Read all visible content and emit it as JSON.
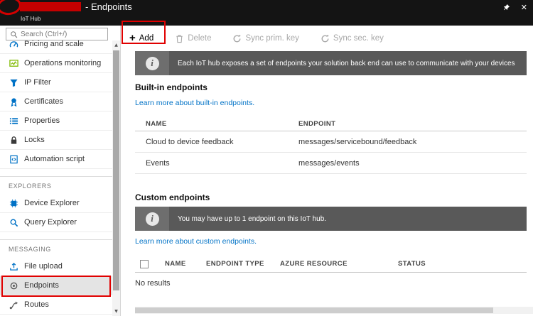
{
  "header": {
    "title": "- Endpoints",
    "subtitle": "IoT Hub"
  },
  "icons": {
    "close": "✕",
    "scroll_up": "▲",
    "scroll_down": "▼",
    "add_plus": "+",
    "info": "i"
  },
  "colors": {
    "annotation_red": "#e00000",
    "link_blue": "#0072c6",
    "banner_gray": "#595959",
    "topbar_black": "#141414"
  },
  "sidebar": {
    "search_placeholder": "Search (Ctrl+/)",
    "sections": {
      "explorers": "EXPLORERS",
      "messaging": "MESSAGING"
    },
    "items": [
      {
        "label": "Pricing and scale"
      },
      {
        "label": "Operations monitoring"
      },
      {
        "label": "IP Filter"
      },
      {
        "label": "Certificates"
      },
      {
        "label": "Properties"
      },
      {
        "label": "Locks"
      },
      {
        "label": "Automation script"
      },
      {
        "label": "Device Explorer"
      },
      {
        "label": "Query Explorer"
      },
      {
        "label": "File upload"
      },
      {
        "label": "Endpoints"
      },
      {
        "label": "Routes"
      }
    ]
  },
  "toolbar": {
    "add_label": "Add",
    "delete_label": "Delete",
    "sync_prim_label": "Sync prim. key",
    "sync_sec_label": "Sync sec. key"
  },
  "main": {
    "intro_banner": "Each IoT hub exposes a set of endpoints your solution back end can use to communicate with your devices",
    "builtin": {
      "heading": "Built-in endpoints",
      "learn_more": "Learn more about built-in endpoints.",
      "columns": {
        "name": "NAME",
        "endpoint": "ENDPOINT"
      },
      "rows": [
        {
          "name": "Cloud to device feedback",
          "endpoint": "messages/servicebound/feedback"
        },
        {
          "name": "Events",
          "endpoint": "messages/events"
        }
      ]
    },
    "custom": {
      "heading": "Custom endpoints",
      "banner": "You may have up to 1 endpoint on this IoT hub.",
      "learn_more": "Learn more about custom endpoints.",
      "columns": {
        "name": "NAME",
        "type": "ENDPOINT TYPE",
        "resource": "AZURE RESOURCE",
        "status": "STATUS"
      },
      "empty": "No results"
    }
  }
}
